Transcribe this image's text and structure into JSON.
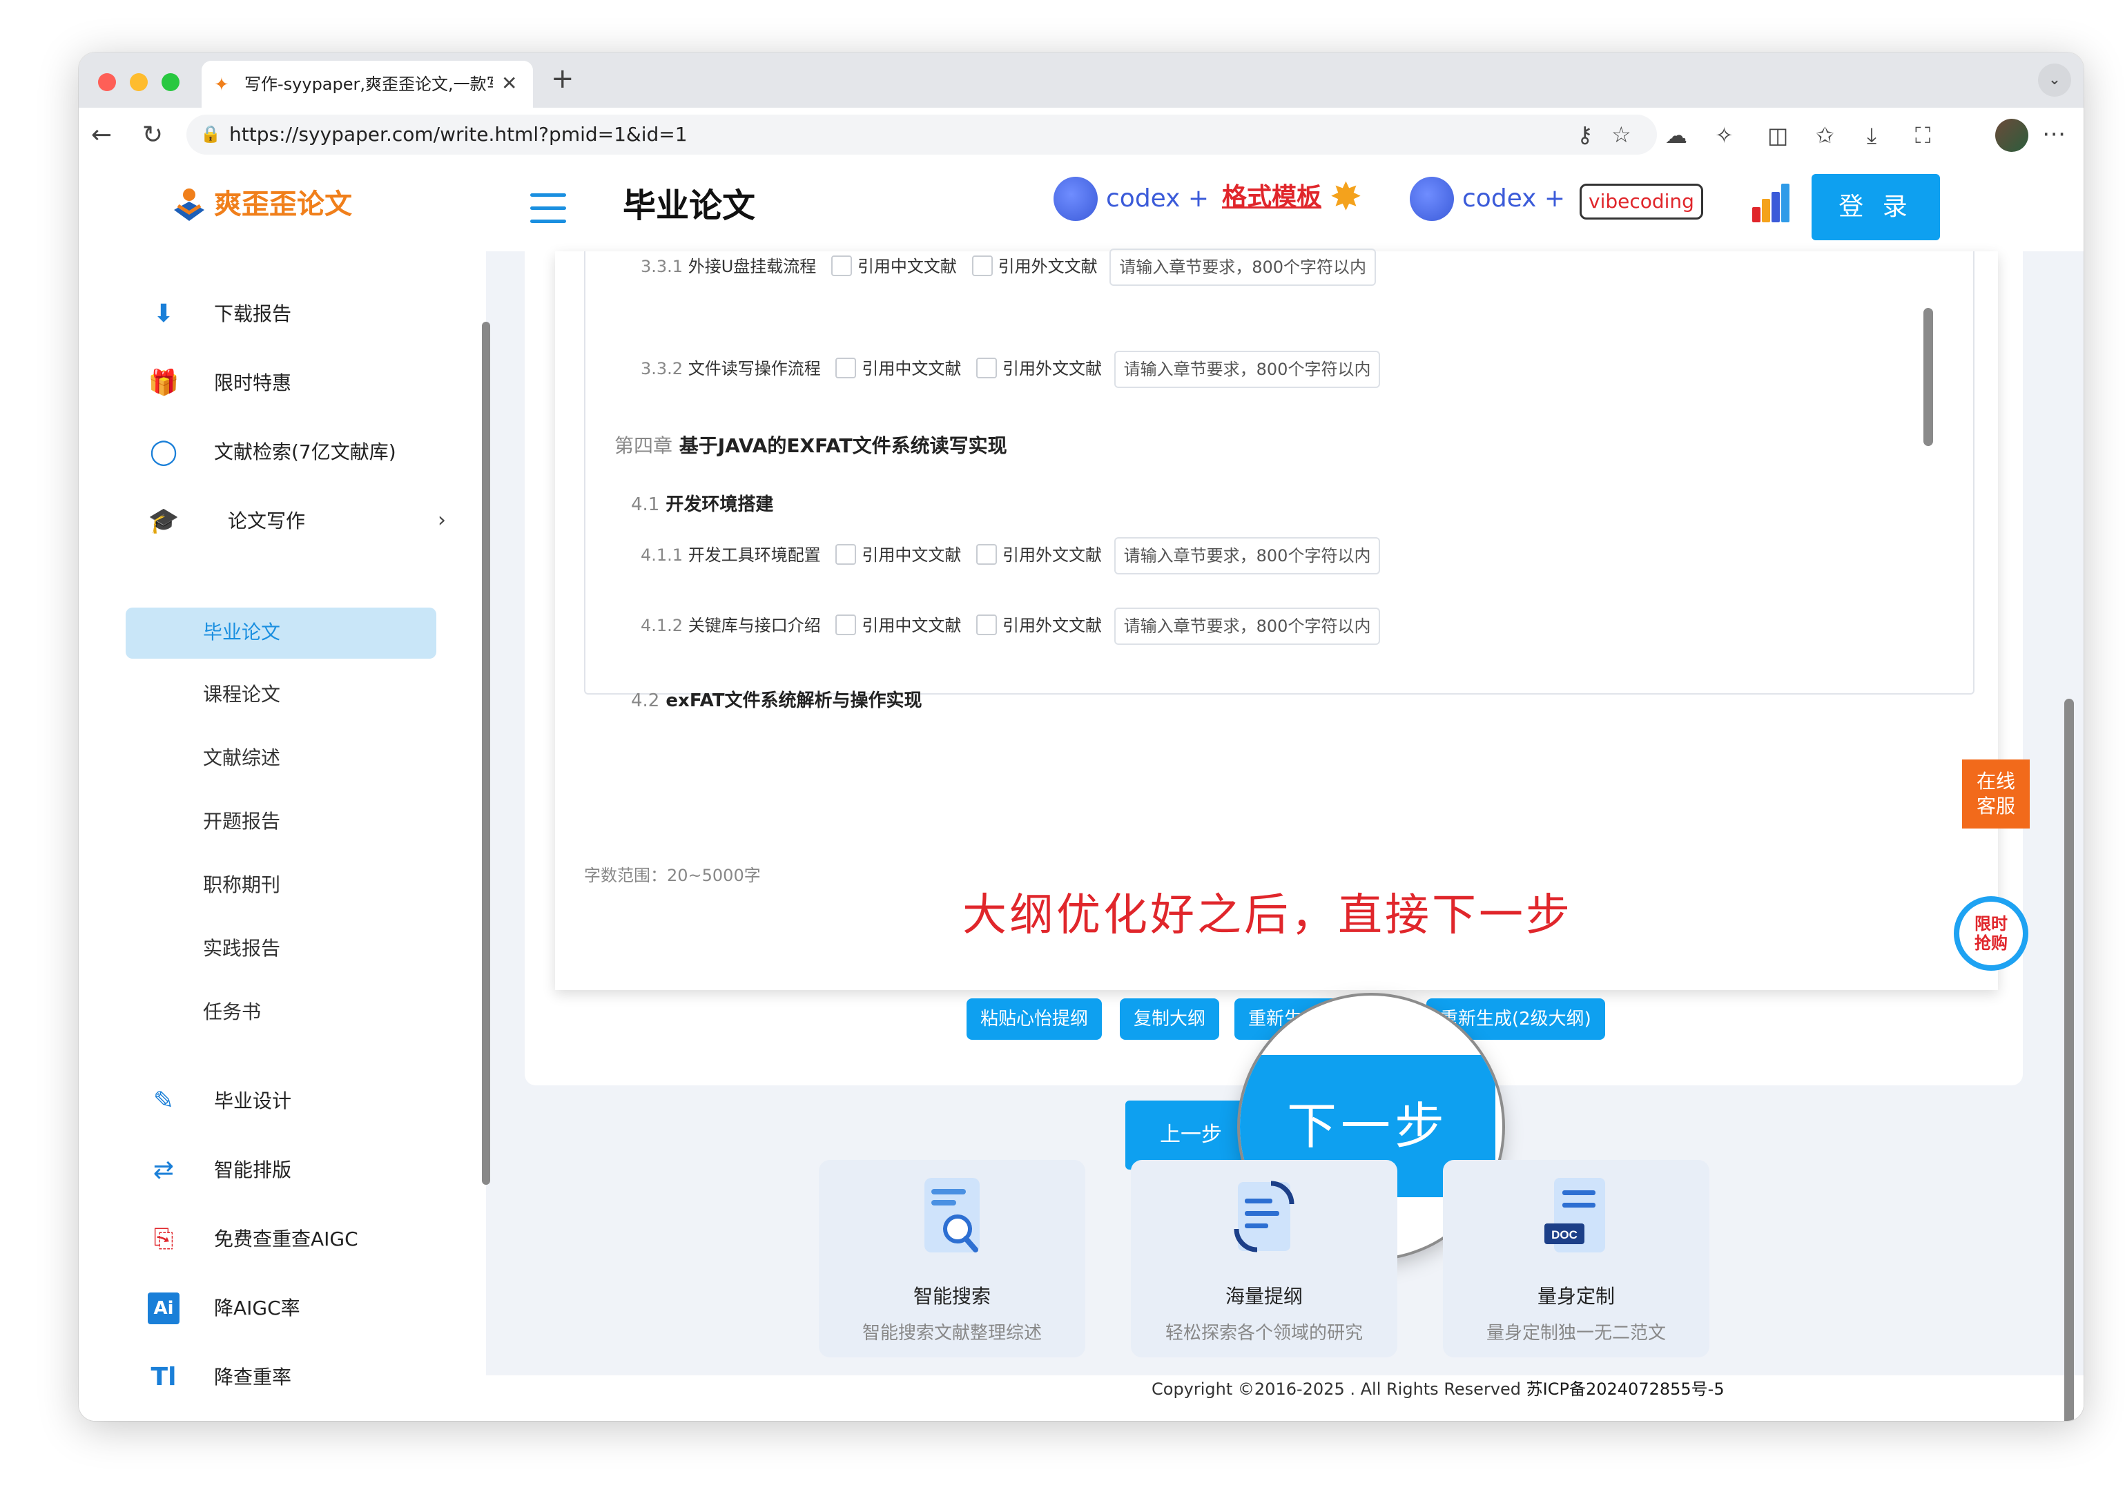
{
  "browser": {
    "tab_title": "写作-syypaper,爽歪歪论文,一款写",
    "url": "https://syypaper.com/write.html?pmid=1&id=1"
  },
  "site": {
    "logo_text": "爽歪歪论文"
  },
  "sidebar": {
    "items": [
      {
        "label": "下载报告",
        "icon": "download-icon"
      },
      {
        "label": "限时特惠",
        "icon": "gift-icon"
      },
      {
        "label": "文献检索(7亿文献库)",
        "icon": "search-icon"
      },
      {
        "label": "论文写作",
        "icon": "graduation-cap-icon"
      }
    ],
    "sub_items": [
      "毕业论文",
      "课程论文",
      "文献综述",
      "开题报告",
      "职称期刊",
      "实践报告",
      "任务书"
    ],
    "items_lower": [
      {
        "label": "毕业设计",
        "icon": "edit-icon"
      },
      {
        "label": "智能排版",
        "icon": "swap-arrows-icon"
      },
      {
        "label": "免费查重查AIGC",
        "icon": "pdf-icon"
      },
      {
        "label": "降AIGC率",
        "icon": "ai-icon"
      },
      {
        "label": "降查重率",
        "icon": "text-size-icon"
      }
    ]
  },
  "header": {
    "title": "毕业论文",
    "banner1_codex": "codex +",
    "banner1_format": "格式模板",
    "banner2_codex": "codex +",
    "banner2_vibe": "vibecoding",
    "login_label": "登 录"
  },
  "outline": {
    "rows": [
      {
        "num": "3.3.1",
        "title": "外接U盘挂载流程"
      },
      {
        "num": "3.3.2",
        "title": "文件读写操作流程"
      },
      {
        "num": "4.1.1",
        "title": "开发工具环境配置"
      },
      {
        "num": "4.1.2",
        "title": "关键库与接口介绍"
      }
    ],
    "cite_cn": "引用中文文献",
    "cite_en": "引用外文文献",
    "req_placeholder": "请输入章节要求，800个字符以内",
    "chapter4_num": "第四章",
    "chapter4_title": "基于JAVA的EXFAT文件系统读写实现",
    "section41_num": "4.1",
    "section41_title": "开发环境搭建",
    "section42_num": "4.2",
    "section42_title": "exFAT文件系统解析与操作实现"
  },
  "word_range": "字数范围：20~5000字",
  "annotation": "大纲优化好之后，直接下一步",
  "actions": {
    "paste": "粘贴心怡提纲",
    "copy": "复制大纲",
    "regen3": "重新生成(3级大纲)",
    "regen2": "重新生成(2级大纲)"
  },
  "steps": {
    "prev": "上一步",
    "next": "下一步"
  },
  "features": [
    {
      "title": "智能搜索",
      "desc": "智能搜索文献整理综述"
    },
    {
      "title": "海量提纲",
      "desc": "轻松探索各个领域的研究"
    },
    {
      "title": "量身定制",
      "desc": "量身定制独一无二范文"
    }
  ],
  "footer": {
    "copyright": "Copyright ©2016-2025 . All Rights Reserved",
    "icp": "苏ICP备2024072855号-5"
  },
  "float": {
    "service": "在线客服",
    "flash_sale": "限时抢购"
  },
  "colors": {
    "accent": "#0ea0f0",
    "active_bg": "#c9e6f8",
    "annotation": "#e0262b",
    "service": "#f26a1b"
  }
}
